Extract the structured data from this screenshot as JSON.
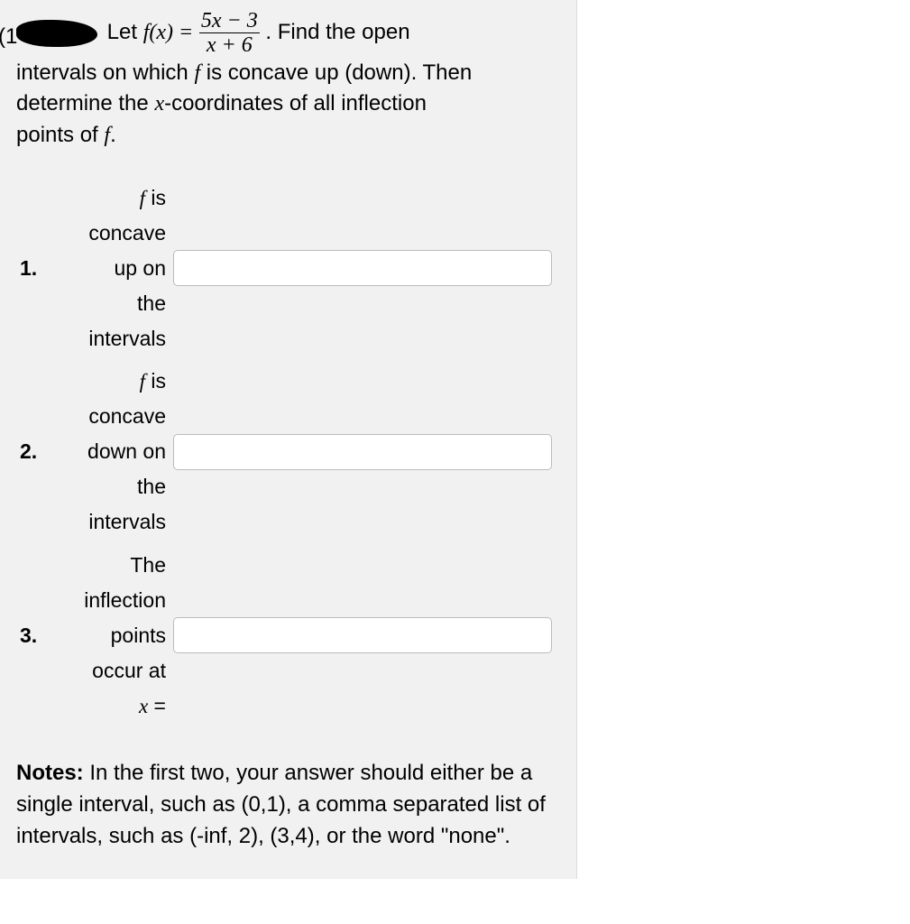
{
  "stem": {
    "let_word": "Let",
    "f_of_x_eq": "f(x) =",
    "frac_num": "5x − 3",
    "frac_den": "x + 6",
    "after_frac": ". Find the open",
    "line2": "intervals on which",
    "f_text": "f",
    "line2b": "is concave up (down). Then",
    "line3": "determine the",
    "x_coords": "x-coordinates of all inflection",
    "line4": "points of",
    "f_text2": "f",
    "period": "."
  },
  "items": [
    {
      "num": "1.",
      "label_l1": "f",
      "label_l1b": " is",
      "label_l2": "concave",
      "label_l3": "up on",
      "label_l4": "the",
      "label_l5": "intervals",
      "value": ""
    },
    {
      "num": "2.",
      "label_l1": "f",
      "label_l1b": " is",
      "label_l2": "concave",
      "label_l3": "down on",
      "label_l4": "the",
      "label_l5": "intervals",
      "value": ""
    },
    {
      "num": "3.",
      "label_l1_plain": "The",
      "label_l2": "inflection",
      "label_l3": "points",
      "label_l4": "occur at",
      "label_l5i": "x",
      "label_l5b": " =",
      "value": ""
    }
  ],
  "notes": {
    "heading": "Notes:",
    "body": " In the first two, your answer should either be a single interval, such as (0,1), a comma separated list of intervals, such as (-inf, 2), (3,4), or the word \"none\"."
  }
}
